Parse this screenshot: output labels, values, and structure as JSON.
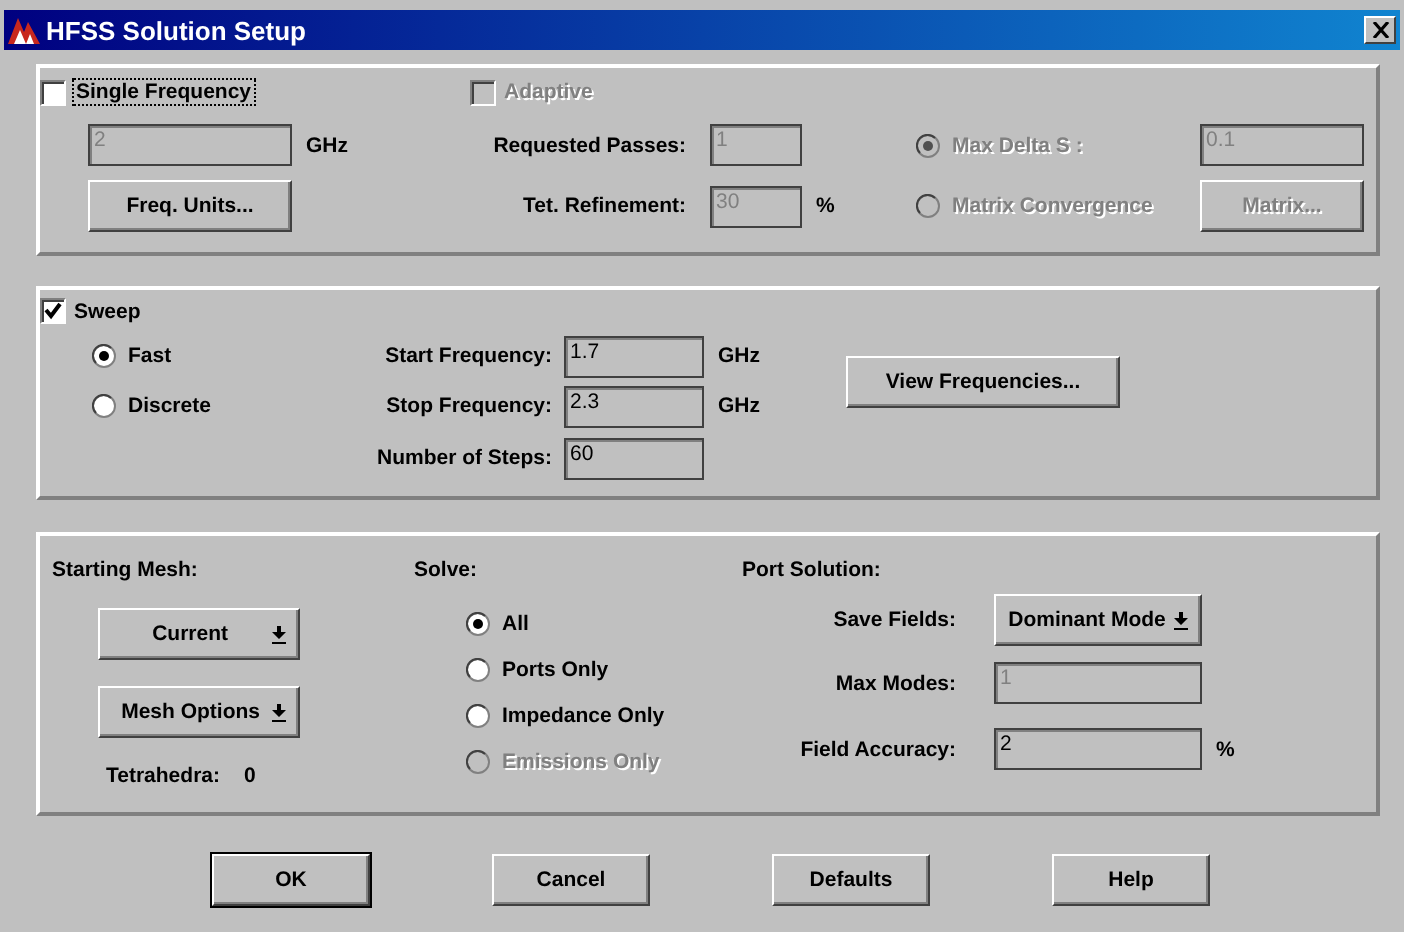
{
  "window": {
    "title": "HFSS Solution Setup"
  },
  "single_frequency": {
    "label": "Single Frequency",
    "checked": false,
    "focused": true,
    "frequency": {
      "value": "2",
      "unit": "GHz",
      "disabled": true
    },
    "units_button": {
      "label": "Freq. Units...",
      "disabled": false
    }
  },
  "adaptive": {
    "label": "Adaptive",
    "checked": false,
    "focused": false,
    "disabled": true,
    "requested_passes": {
      "label": "Requested Passes:",
      "value": "1",
      "disabled": true
    },
    "tet_refinement": {
      "label": "Tet. Refinement:",
      "value": "30",
      "unit": "%",
      "disabled": true
    },
    "convergence": [
      {
        "label": "Max Delta S :",
        "selected": true,
        "disabled": true
      },
      {
        "label": "Matrix Convergence",
        "selected": false,
        "disabled": true
      }
    ],
    "max_delta_s": {
      "value": "0.1",
      "disabled": true
    },
    "matrix_button": {
      "label": "Matrix...",
      "disabled": true
    }
  },
  "sweep": {
    "label": "Sweep",
    "checked": true,
    "focused": false,
    "types": [
      {
        "label": "Fast",
        "selected": true,
        "disabled": false
      },
      {
        "label": "Discrete",
        "selected": false,
        "disabled": false
      }
    ],
    "fields": [
      {
        "label": "Start Frequency:",
        "value": "1.7",
        "unit": "GHz",
        "disabled": false
      },
      {
        "label": "Stop Frequency:",
        "value": "2.3",
        "unit": "GHz",
        "disabled": false
      },
      {
        "label": "Number of Steps:",
        "value": "60",
        "disabled": false
      }
    ],
    "view_button": {
      "label": "View Frequencies...",
      "disabled": false
    }
  },
  "starting_mesh": {
    "label": "Starting Mesh:",
    "dropdown": "Current",
    "options_button": "Mesh Options",
    "tetrahedra_label": "Tetrahedra:",
    "tetrahedra_value": "0"
  },
  "solve": {
    "label": "Solve:",
    "options": [
      {
        "label": "All",
        "selected": true,
        "disabled": false
      },
      {
        "label": "Ports Only",
        "selected": false,
        "disabled": false
      },
      {
        "label": "Impedance Only",
        "selected": false,
        "disabled": false
      },
      {
        "label": "Emissions Only",
        "selected": false,
        "disabled": true
      }
    ]
  },
  "port_solution": {
    "label": "Port Solution:",
    "save_fields": {
      "label": "Save Fields:",
      "value": "Dominant Mode"
    },
    "max_modes": {
      "label": "Max Modes:",
      "value": "1",
      "disabled": true
    },
    "field_accuracy": {
      "label": "Field Accuracy:",
      "value": "2",
      "unit": "%",
      "disabled": false
    }
  },
  "buttons": [
    {
      "label": "OK",
      "default": true
    },
    {
      "label": "Cancel",
      "default": false
    },
    {
      "label": "Defaults",
      "default": false
    },
    {
      "label": "Help",
      "default": false
    }
  ]
}
